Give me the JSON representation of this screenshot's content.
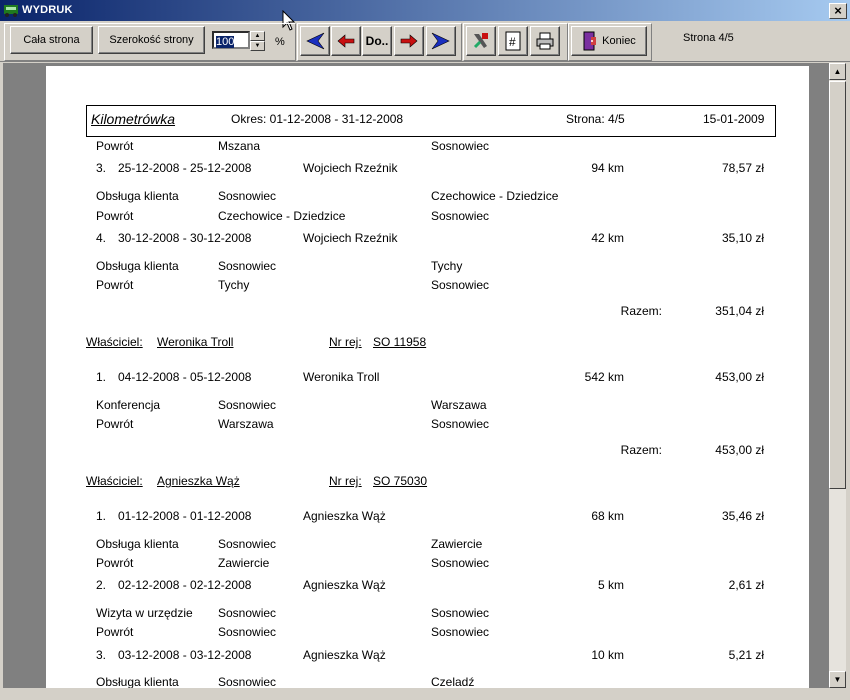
{
  "window": {
    "title": "WYDRUK",
    "close_symbol": "×"
  },
  "toolbar": {
    "whole_page": "Cała strona",
    "page_width": "Szerokość strony",
    "zoom_value": "100",
    "zoom_unit": "%",
    "goto_label": "Do..",
    "exit_label": "Koniec",
    "page_indicator": "Strona 4/5"
  },
  "icons": {
    "first": "first-page-icon",
    "prev": "previous-page-icon",
    "next": "next-page-icon",
    "last": "last-page-icon",
    "tools": "tools-icon",
    "number": "page-number-icon",
    "print": "printer-icon",
    "exit": "exit-door-icon"
  },
  "header": {
    "title": "Kilometrówka",
    "period": "Okres: 01-12-2008 - 31-12-2008",
    "page": "Strona: 4/5",
    "date": "15-01-2009"
  },
  "sections": [
    {
      "trips": [
        {
          "no": "",
          "dates": "",
          "person": "",
          "km": "",
          "amount": "",
          "legs": [
            {
              "purpose": "Powrót",
              "from": "Mszana",
              "to": "Sosnowiec"
            }
          ]
        },
        {
          "no": "3.",
          "dates": "25-12-2008 - 25-12-2008",
          "person": "Wojciech Rzeźnik",
          "km": "94 km",
          "amount": "78,57 zł",
          "legs": [
            {
              "purpose": "Obsługa klienta",
              "from": "Sosnowiec",
              "to": "Czechowice - Dziedzice"
            },
            {
              "purpose": "Powrót",
              "from": "Czechowice - Dziedzice",
              "to": "Sosnowiec"
            }
          ]
        },
        {
          "no": "4.",
          "dates": "30-12-2008 - 30-12-2008",
          "person": "Wojciech Rzeźnik",
          "km": "42 km",
          "amount": "35,10 zł",
          "legs": [
            {
              "purpose": "Obsługa klienta",
              "from": "Sosnowiec",
              "to": "Tychy"
            },
            {
              "purpose": "Powrót",
              "from": "Tychy",
              "to": "Sosnowiec"
            }
          ]
        }
      ],
      "total_label": "Razem:",
      "total": "351,04 zł"
    },
    {
      "owner_label": "Właściciel:",
      "owner": "Weronika Troll",
      "reg_label": "Nr rej:",
      "reg": "SO 11958",
      "trips": [
        {
          "no": "1.",
          "dates": "04-12-2008 - 05-12-2008",
          "person": "Weronika Troll",
          "km": "542 km",
          "amount": "453,00 zł",
          "legs": [
            {
              "purpose": "Konferencja",
              "from": "Sosnowiec",
              "to": "Warszawa"
            },
            {
              "purpose": "Powrót",
              "from": "Warszawa",
              "to": "Sosnowiec"
            }
          ]
        }
      ],
      "total_label": "Razem:",
      "total": "453,00 zł"
    },
    {
      "owner_label": "Właściciel:",
      "owner": "Agnieszka Wąż",
      "reg_label": "Nr rej:",
      "reg": "SO 75030",
      "trips": [
        {
          "no": "1.",
          "dates": "01-12-2008 - 01-12-2008",
          "person": "Agnieszka Wąż",
          "km": "68 km",
          "amount": "35,46 zł",
          "legs": [
            {
              "purpose": "Obsługa klienta",
              "from": "Sosnowiec",
              "to": "Zawiercie"
            },
            {
              "purpose": "Powrót",
              "from": "Zawiercie",
              "to": "Sosnowiec"
            }
          ]
        },
        {
          "no": "2.",
          "dates": "02-12-2008 - 02-12-2008",
          "person": "Agnieszka Wąż",
          "km": "5 km",
          "amount": "2,61 zł",
          "legs": [
            {
              "purpose": "Wizyta w urzędzie",
              "from": "Sosnowiec",
              "to": "Sosnowiec"
            },
            {
              "purpose": "Powrót",
              "from": "Sosnowiec",
              "to": "Sosnowiec"
            }
          ]
        },
        {
          "no": "3.",
          "dates": "03-12-2008 - 03-12-2008",
          "person": "Agnieszka Wąż",
          "km": "10 km",
          "amount": "5,21 zł",
          "legs": [
            {
              "purpose": "Obsługa klienta",
              "from": "Sosnowiec",
              "to": "Czeladź"
            }
          ]
        }
      ]
    }
  ]
}
